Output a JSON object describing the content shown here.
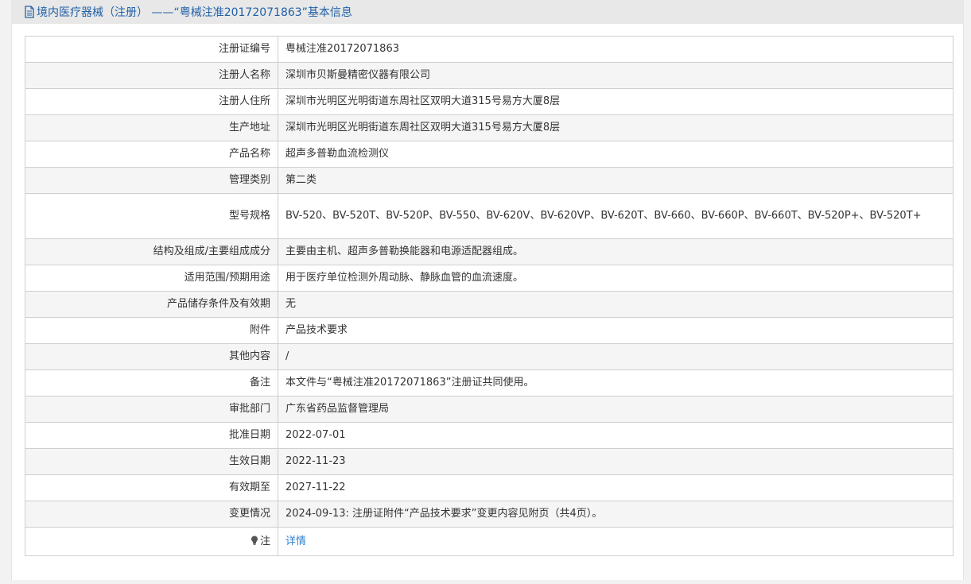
{
  "header": {
    "title": "境内医疗器械（注册） ——“粤械注准20172071863”基本信息",
    "icon": "document-icon"
  },
  "rows": [
    {
      "label": "注册证编号",
      "value": "粤械注准20172071863"
    },
    {
      "label": "注册人名称",
      "value": "深圳市贝斯曼精密仪器有限公司"
    },
    {
      "label": "注册人住所",
      "value": "深圳市光明区光明街道东周社区双明大道315号易方大厦8层"
    },
    {
      "label": "生产地址",
      "value": "深圳市光明区光明街道东周社区双明大道315号易方大厦8层"
    },
    {
      "label": "产品名称",
      "value": "超声多普勒血流检测仪"
    },
    {
      "label": "管理类别",
      "value": "第二类"
    },
    {
      "label": "型号规格",
      "value": "BV-520、BV-520T、BV-520P、BV-550、BV-620V、BV-620VP、BV-620T、BV-660、BV-660P、BV-660T、BV-520P+、BV-520T+"
    },
    {
      "label": "结构及组成/主要组成成分",
      "value": "主要由主机、超声多普勒换能器和电源适配器组成。"
    },
    {
      "label": "适用范围/预期用途",
      "value": "用于医疗单位检测外周动脉、静脉血管的血流速度。"
    },
    {
      "label": "产品储存条件及有效期",
      "value": "无"
    },
    {
      "label": "附件",
      "value": "产品技术要求"
    },
    {
      "label": "其他内容",
      "value": "/"
    },
    {
      "label": "备注",
      "value": "本文件与“粤械注准20172071863”注册证共同使用。"
    },
    {
      "label": "审批部门",
      "value": "广东省药品监督管理局"
    },
    {
      "label": "批准日期",
      "value": "2022-07-01"
    },
    {
      "label": "生效日期",
      "value": "2022-11-23"
    },
    {
      "label": "有效期至",
      "value": "2027-11-22"
    },
    {
      "label": "变更情况",
      "value": "2024-09-13: 注册证附件“产品技术要求”变更内容见附页（共4页）。"
    }
  ],
  "note_row": {
    "label": "注",
    "icon": "lightbulb-icon",
    "link_text": "详情"
  },
  "colors": {
    "title": "#2161a7",
    "link": "#2f7fd0",
    "border": "#cfcfcf",
    "stripe": "#f5f5f5"
  }
}
